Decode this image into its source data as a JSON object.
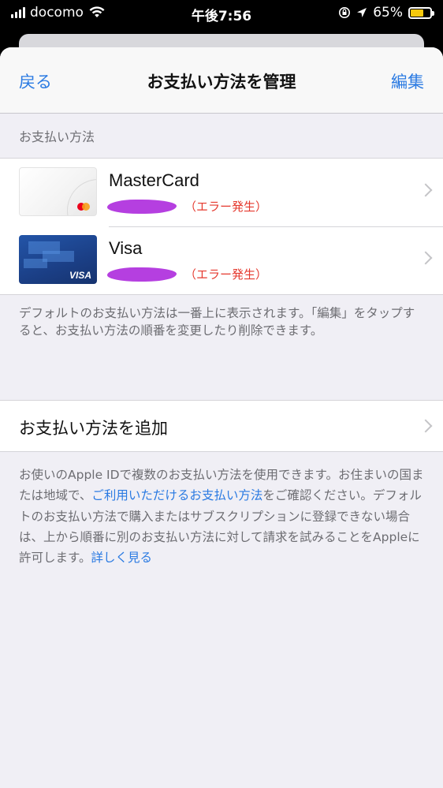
{
  "status_bar": {
    "carrier": "docomo",
    "time": "午後7:56",
    "battery": "65%",
    "battery_level": 0.65,
    "colors": {
      "battery_fill": "#f6c90e"
    }
  },
  "nav": {
    "back": "戻る",
    "title": "お支払い方法を管理",
    "edit": "編集"
  },
  "payment_section": {
    "header": "お支払い方法",
    "methods": [
      {
        "name": "MasterCard",
        "status": "（エラー発生）",
        "card_icon": "mastercard-card-icon"
      },
      {
        "name": "Visa",
        "status": "（エラー発生）",
        "card_icon": "visa-card-icon",
        "card_brand_text": "VISA"
      }
    ],
    "footer": "デフォルトのお支払い方法は一番上に表示されます。「編集」をタップすると、お支払い方法の順番を変更したり削除できます。"
  },
  "add_payment": {
    "label": "お支払い方法を追加"
  },
  "info": {
    "text_1": "お使いのApple IDで複数のお支払い方法を使用できます。お住まいの国または地域で、",
    "link_1": "ご利用いただけるお支払い方法",
    "text_2": "をご確認ください。デフォルトのお支払い方法で購入またはサブスクリプションに登録できない場合は、上から順番に別のお支払い方法に対して請求を試みることをAppleに許可します。",
    "link_2": "詳しく見る"
  },
  "colors": {
    "accent": "#2a7ae2",
    "error": "#e5392e",
    "redaction": "#b53fe0"
  }
}
